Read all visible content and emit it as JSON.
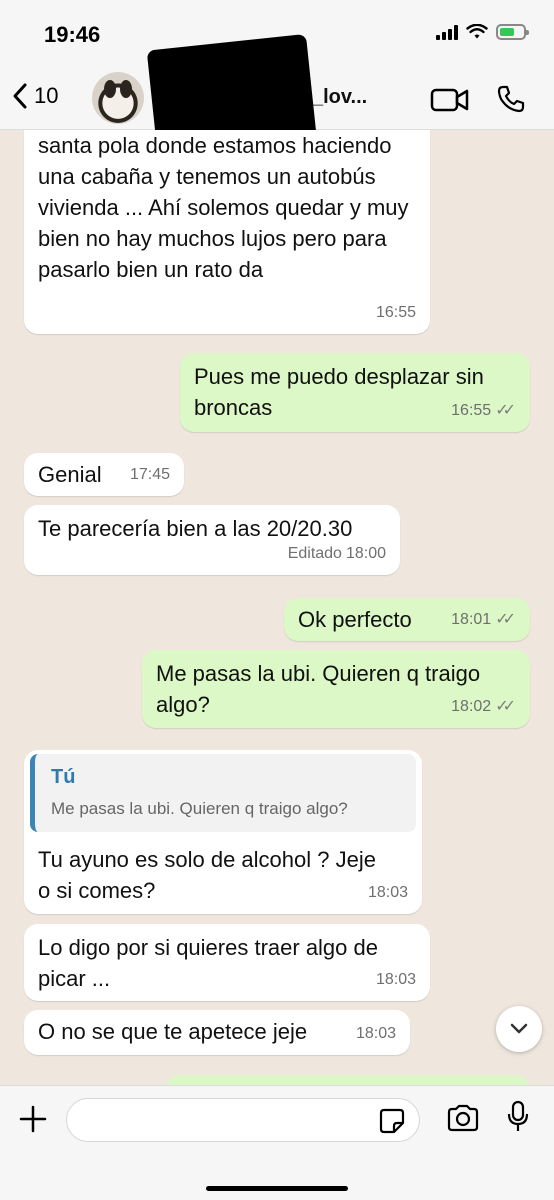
{
  "status": {
    "time": "19:46"
  },
  "header": {
    "back_count": "10",
    "contact_name": "_lov..."
  },
  "messages": [
    {
      "dir": "in",
      "text": "santa pola donde estamos haciendo una cabaña y tenemos un autobús vivienda ... Ahí solemos quedar y muy bien no hay muchos lujos pero para pasarlo bien un rato da",
      "time": "16:55"
    },
    {
      "dir": "out",
      "text": "Pues me puedo desplazar sin broncas",
      "time": "16:55"
    },
    {
      "dir": "in",
      "text": "Genial",
      "time": "17:45"
    },
    {
      "dir": "in",
      "text": "Te parecería bien a  las 20/20.30",
      "edited": "Editado",
      "time": "18:00"
    },
    {
      "dir": "out",
      "text": "Ok perfecto",
      "time": "18:01"
    },
    {
      "dir": "out",
      "text": "Me pasas la ubi. Quieren q traigo algo?",
      "time": "18:02"
    },
    {
      "dir": "in",
      "quote_author": "Tú",
      "quote_text": "Me pasas la ubi. Quieren q traigo algo?",
      "text": "Tu ayuno es solo de alcohol ? Jeje o si comes?",
      "time": "18:03"
    },
    {
      "dir": "in",
      "text": "Lo digo por si quieres traer algo de picar ...",
      "time": "18:03"
    },
    {
      "dir": "in",
      "text": "O no se que te apetece jeje",
      "time": "18:03"
    }
  ],
  "icons": {
    "back": "chevron-left-icon",
    "video": "video-camera-icon",
    "call": "phone-icon",
    "attach": "plus-icon",
    "sticker": "sticker-icon",
    "camera": "camera-icon",
    "mic": "microphone-icon",
    "scroll": "chevron-down-icon"
  },
  "colors": {
    "incoming": "#ffffff",
    "outgoing": "#dcf8c6",
    "chat_bg": "#efe7dd",
    "quote_accent": "#3b85b5"
  }
}
